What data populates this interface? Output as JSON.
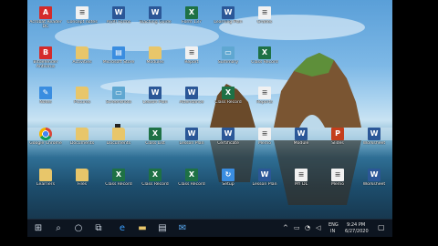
{
  "desktop": {
    "icons": [
      {
        "label": "Acrobat Reader DC",
        "kind": "pdf",
        "glyph": "A"
      },
      {
        "label": "Concept notes",
        "kind": "file",
        "glyph": "≡"
      },
      {
        "label": "AGRI Forms",
        "kind": "word",
        "glyph": "W"
      },
      {
        "label": "Teaching Guide",
        "kind": "word",
        "glyph": "W"
      },
      {
        "label": "Form 137",
        "kind": "excel",
        "glyph": "X"
      },
      {
        "label": "Learning Plan",
        "kind": "word",
        "glyph": "W"
      },
      {
        "label": "Grades",
        "kind": "file",
        "glyph": "≡"
      },
      {
        "label": "Bitdefender Antivirus",
        "kind": "pdf",
        "glyph": "B"
      },
      {
        "label": "Activities",
        "kind": "folder",
        "glyph": ""
      },
      {
        "label": "Microsoft Store",
        "kind": "app",
        "glyph": "▤"
      },
      {
        "label": "Modules",
        "kind": "folder",
        "glyph": ""
      },
      {
        "label": "Report",
        "kind": "file",
        "glyph": "≡"
      },
      {
        "label": "Summary",
        "kind": "image",
        "glyph": "▭"
      },
      {
        "label": "Class Record",
        "kind": "excel",
        "glyph": "X"
      },
      {
        "label": "Notes",
        "kind": "app",
        "glyph": "✎"
      },
      {
        "label": "Pictures",
        "kind": "folder",
        "glyph": ""
      },
      {
        "label": "Screenshots",
        "kind": "image",
        "glyph": "▭"
      },
      {
        "label": "Lesson Plan",
        "kind": "word",
        "glyph": "W"
      },
      {
        "label": "Attendance",
        "kind": "word",
        "glyph": "W"
      },
      {
        "label": "Class Record",
        "kind": "excel",
        "glyph": "X"
      },
      {
        "label": "Reports",
        "kind": "file",
        "glyph": "≡"
      },
      {
        "label": "Google Chrome",
        "kind": "chrome",
        "glyph": ""
      },
      {
        "label": "Documents",
        "kind": "folder",
        "glyph": ""
      },
      {
        "label": "Documents",
        "kind": "folder",
        "glyph": ""
      },
      {
        "label": "Class List",
        "kind": "excel",
        "glyph": "X"
      },
      {
        "label": "Lesson Plan",
        "kind": "word",
        "glyph": "W"
      },
      {
        "label": "Certificate",
        "kind": "word",
        "glyph": "W"
      },
      {
        "label": "Memo",
        "kind": "file",
        "glyph": "≡"
      },
      {
        "label": "Module",
        "kind": "word",
        "glyph": "W"
      },
      {
        "label": "Slides",
        "kind": "ppt",
        "glyph": "P"
      },
      {
        "label": "Worksheet",
        "kind": "word",
        "glyph": "W"
      },
      {
        "label": "Learners",
        "kind": "folder",
        "glyph": ""
      },
      {
        "label": "Files",
        "kind": "folder",
        "glyph": ""
      },
      {
        "label": "Class Record",
        "kind": "excel",
        "glyph": "X"
      },
      {
        "label": "Class Record",
        "kind": "excel",
        "glyph": "X"
      },
      {
        "label": "Class Record",
        "kind": "excel",
        "glyph": "X"
      },
      {
        "label": "Setup",
        "kind": "app",
        "glyph": "↻"
      },
      {
        "label": "Lesson Plan",
        "kind": "word",
        "glyph": "W"
      },
      {
        "label": "MY DL",
        "kind": "file",
        "glyph": "≡"
      },
      {
        "label": "Memo",
        "kind": "file",
        "glyph": "≡"
      },
      {
        "label": "Worksheet",
        "kind": "word",
        "glyph": "W"
      }
    ]
  },
  "taskbar": {
    "start_glyph": "⊞",
    "search_glyph": "⌕",
    "cortana_glyph": "○",
    "taskview_glyph": "⧉",
    "edge_glyph": "e",
    "explorer_glyph": "▬",
    "store_glyph": "▤",
    "mail_glyph": "✉",
    "tray": {
      "lang": "ENG",
      "region": "IN",
      "time": "9:24 PM",
      "date": "6/27/2020"
    }
  },
  "colors": {
    "taskbar": "#0d1520",
    "word": "#2b5797",
    "excel": "#1e7145",
    "pdf": "#d42b2b"
  }
}
